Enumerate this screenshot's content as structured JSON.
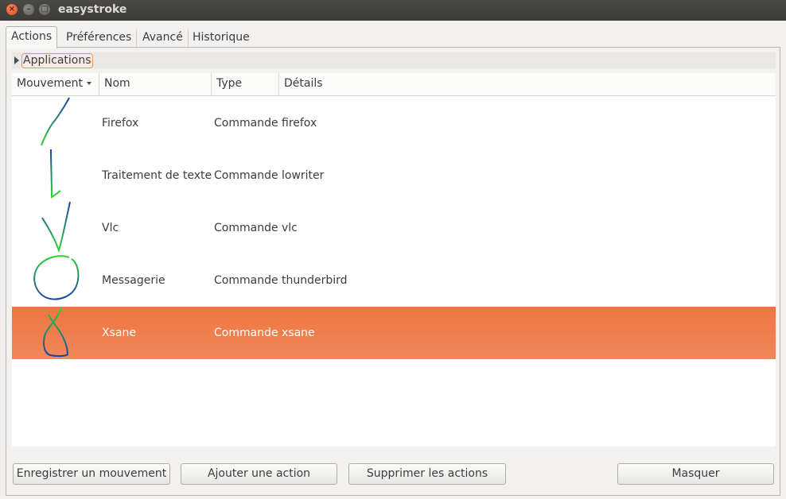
{
  "window": {
    "title": "easystroke",
    "buttons": {
      "close": "×",
      "minimize": "–",
      "maximize": "□"
    }
  },
  "tabs": [
    {
      "label": "Actions",
      "active": true
    },
    {
      "label": "Préférences",
      "active": false
    },
    {
      "label": "Avancé",
      "active": false
    },
    {
      "label": "Historique",
      "active": false
    }
  ],
  "expander": {
    "label": "Applications",
    "expanded": false
  },
  "table": {
    "columns": [
      "Mouvement",
      "Nom",
      "Type",
      "Détails"
    ],
    "sort_column": "Mouvement",
    "rows": [
      {
        "gesture": "diagonal-stroke",
        "name": "Firefox",
        "type": "Commande",
        "details": "firefox",
        "selected": false
      },
      {
        "gesture": "l-stroke",
        "name": "Traitement de texte",
        "type": "Commande",
        "details": "lowriter",
        "selected": false
      },
      {
        "gesture": "v-stroke",
        "name": "Vlc",
        "type": "Commande",
        "details": "vlc",
        "selected": false
      },
      {
        "gesture": "circle-stroke",
        "name": "Messagerie",
        "type": "Commande",
        "details": "thunderbird",
        "selected": false
      },
      {
        "gesture": "loop-stroke",
        "name": "Xsane",
        "type": "Commande",
        "details": "xsane",
        "selected": true
      }
    ]
  },
  "buttons": {
    "record": "Enregistrer un mouvement",
    "add": "Ajouter une action",
    "delete": "Supprimer les actions",
    "hide": "Masquer"
  },
  "colors": {
    "selection": "#f07746",
    "stroke_start": "#1b3fb0",
    "stroke_end": "#2fd42f",
    "titlebar": "#3c3b37"
  }
}
